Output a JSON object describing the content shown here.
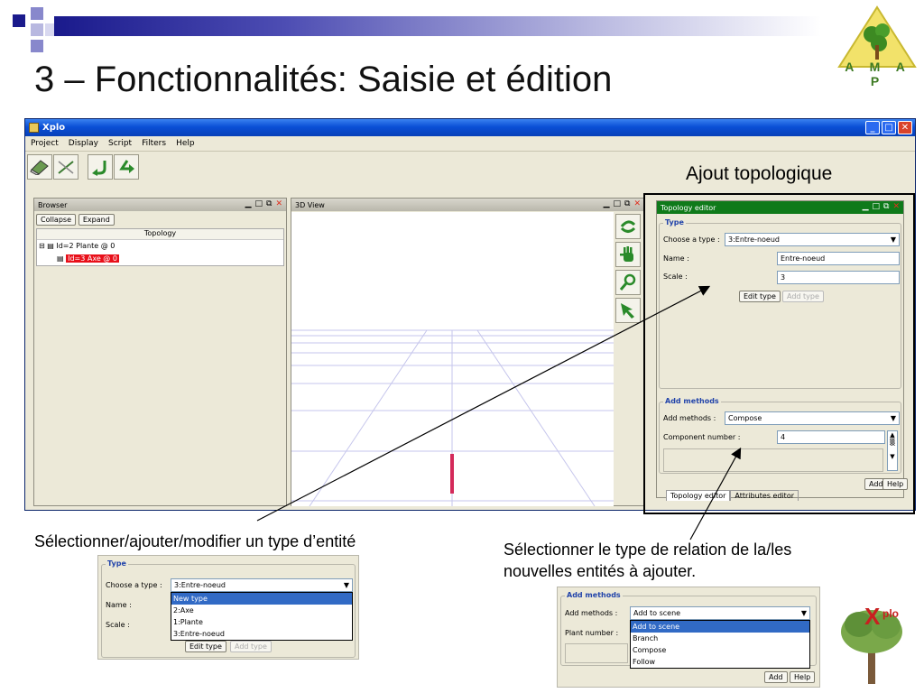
{
  "slide": {
    "title": "3 – Fonctionnalités: Saisie et édition",
    "logo_text": "A M A P",
    "annotation_title": "Ajout topologique",
    "caption_left": "Sélectionner/ajouter/modifier un type d’entité",
    "caption_right_1": "Sélectionner le type de relation de la/les",
    "caption_right_2": "nouvelles entités à ajouter.",
    "xplo_logo_text": "plo"
  },
  "window": {
    "title": "Xplo",
    "menu": [
      "Project",
      "Display",
      "Script",
      "Filters",
      "Help"
    ]
  },
  "browser": {
    "title": "Browser",
    "collapse": "Collapse",
    "expand": "Expand",
    "column_header": "Topology",
    "tree": [
      "Id=2 Plante @ 0",
      "Id=3 Axe @ 0"
    ]
  },
  "view3d": {
    "title": "3D View"
  },
  "topology_editor": {
    "title": "Topology editor",
    "type_group": "Type",
    "choose_type_label": "Choose a type :",
    "choose_type_value": "3:Entre-noeud",
    "name_label": "Name :",
    "name_value": "Entre-noeud",
    "scale_label": "Scale :",
    "scale_value": "3",
    "edit_type": "Edit type",
    "add_type": "Add type",
    "methods_group": "Add methods",
    "methods_label": "Add methods :",
    "methods_value": "Compose",
    "component_label": "Component number :",
    "component_value": "4",
    "add": "Add",
    "help": "Help",
    "tab1": "Topology editor",
    "tab2": "Attributes editor"
  },
  "inset_type": {
    "group": "Type",
    "choose_label": "Choose a type :",
    "choose_value": "3:Entre-noeud",
    "name_label": "Name :",
    "scale_label": "Scale :",
    "edit_type": "Edit type",
    "add_type": "Add type",
    "options": [
      "New type",
      "2:Axe",
      "1:Plante",
      "3:Entre-noeud"
    ]
  },
  "inset_methods": {
    "group": "Add methods",
    "methods_label": "Add methods :",
    "methods_value": "Add to scene",
    "plant_label": "Plant number :",
    "options": [
      "Add to scene",
      "Branch",
      "Compose",
      "Follow"
    ],
    "add": "Add",
    "help": "Help"
  }
}
